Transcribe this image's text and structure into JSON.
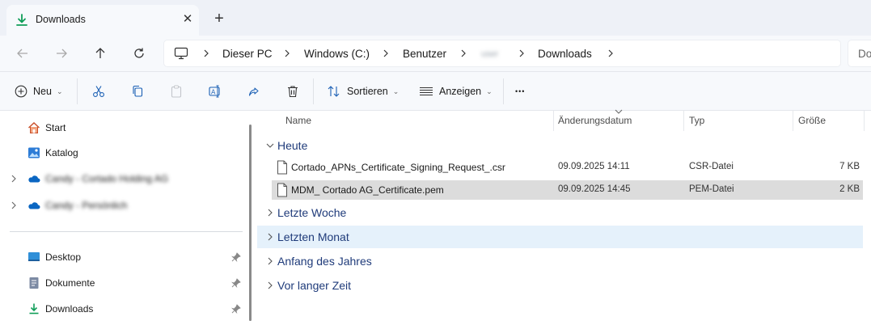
{
  "tab": {
    "title": "Downloads",
    "close_glyph": "✕",
    "new_tab_glyph": "+"
  },
  "breadcrumb": {
    "items": [
      "Dieser PC",
      "Windows (C:)",
      "Benutzer",
      "user",
      "Downloads"
    ],
    "search_partial": "Do"
  },
  "toolbar": {
    "new_label": "Neu",
    "sort_label": "Sortieren",
    "view_label": "Anzeigen",
    "more_glyph": "•••"
  },
  "nav": {
    "items": [
      {
        "label": "Start",
        "icon": "home-icon"
      },
      {
        "label": "Katalog",
        "icon": "gallery-icon"
      },
      {
        "label": "Candy - Cortado Holding AG",
        "icon": "onedrive-icon",
        "blurred": true
      },
      {
        "label": "Candy - Persönlich",
        "icon": "onedrive-icon",
        "blurred": true
      },
      {
        "label": "Desktop",
        "icon": "desktop-icon",
        "pinned": true
      },
      {
        "label": "Dokumente",
        "icon": "documents-icon",
        "pinned": true
      },
      {
        "label": "Downloads",
        "icon": "downloads-icon",
        "pinned": true
      }
    ]
  },
  "columns": {
    "name": "Name",
    "date": "Änderungsdatum",
    "type": "Typ",
    "size": "Größe"
  },
  "groups": [
    {
      "label": "Heute",
      "expanded": true
    },
    {
      "label": "Letzte Woche",
      "expanded": false
    },
    {
      "label": "Letzten Monat",
      "expanded": false
    },
    {
      "label": "Anfang des Jahres",
      "expanded": false
    },
    {
      "label": "Vor langer Zeit",
      "expanded": false
    }
  ],
  "files": [
    {
      "name": "Cortado_APNs_Certificate_Signing_Request_.csr",
      "date": "09.09.2025 14:11",
      "type": "CSR-Datei",
      "size": "7 KB",
      "selected": false
    },
    {
      "name": "MDM_ Cortado AG_Certificate.pem",
      "date": "09.09.2025 14:45",
      "type": "PEM-Datei",
      "size": "2 KB",
      "selected": true
    }
  ],
  "colors": {
    "accent": "#0f9d58",
    "group_text": "#1f3b7a",
    "selection": "#dcdcdc",
    "hover": "#e5f1fb",
    "folder": "#f3c33b",
    "onedrive": "#0a66c2"
  }
}
